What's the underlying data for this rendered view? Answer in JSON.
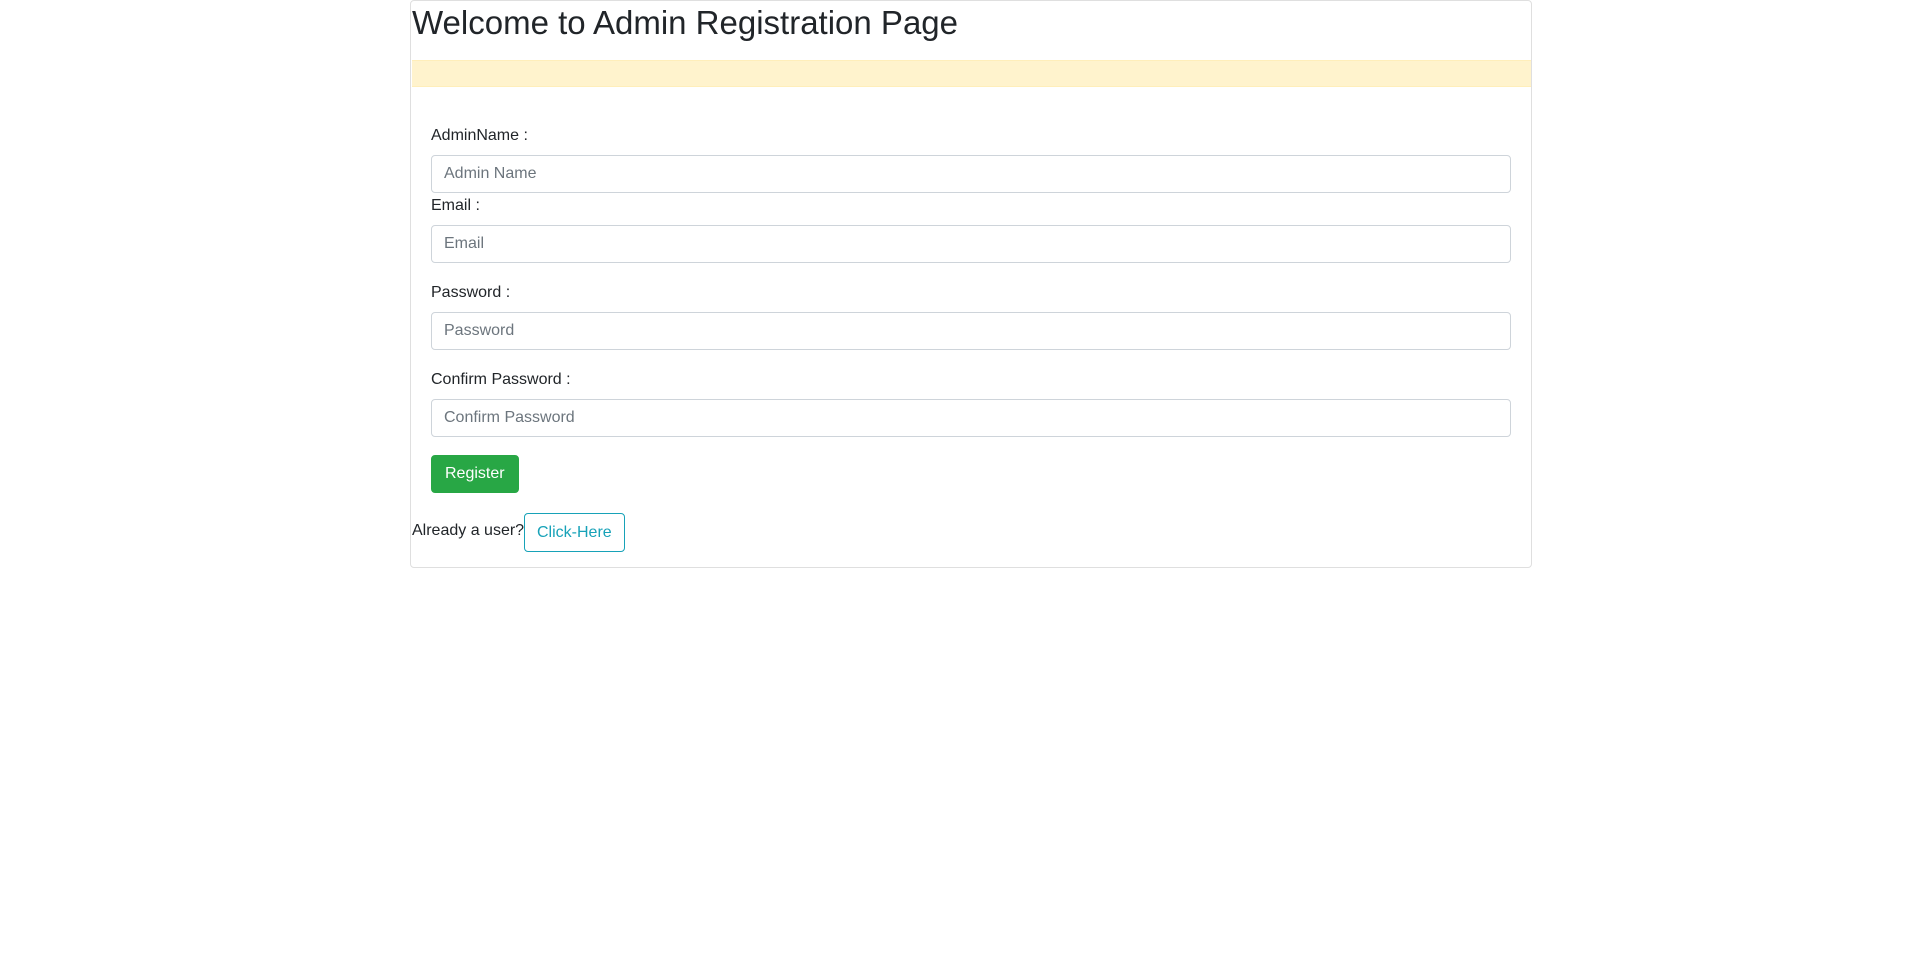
{
  "page": {
    "title": "Welcome to Admin Registration Page"
  },
  "form": {
    "admin_name_label": "AdminName :",
    "admin_name_placeholder": "Admin Name",
    "admin_name_value": "",
    "email_label": "Email :",
    "email_placeholder": "Email",
    "email_value": "",
    "password_label": "Password :",
    "password_placeholder": "Password",
    "password_value": "",
    "confirm_password_label": "Confirm Password :",
    "confirm_password_placeholder": "Confirm Password",
    "confirm_password_value": "",
    "register_label": "Register"
  },
  "footer": {
    "already_user_text": "Already a user?",
    "click_here_label": "Click-Here"
  },
  "colors": {
    "alert_background": "#fff3cd",
    "register_button": "#28a745",
    "click_here_outline": "#17a2b8"
  }
}
